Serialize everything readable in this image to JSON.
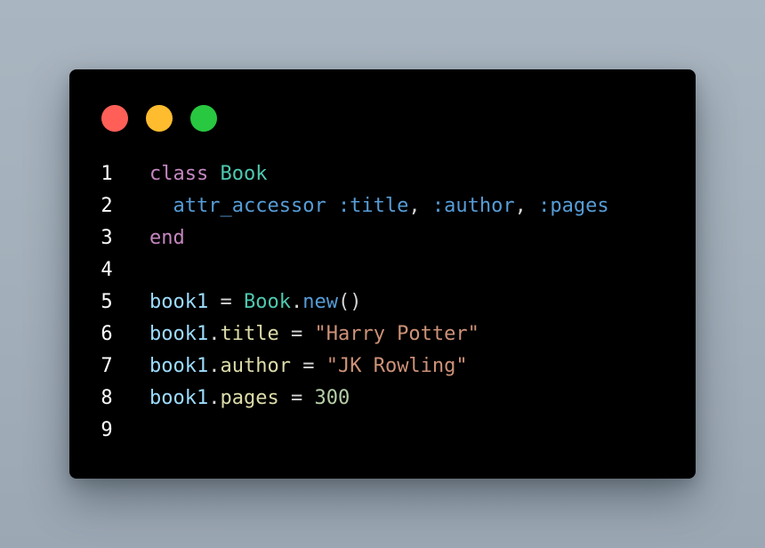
{
  "window_controls": [
    {
      "name": "close",
      "color": "#ff5f57"
    },
    {
      "name": "minimize",
      "color": "#febc2e"
    },
    {
      "name": "maximize",
      "color": "#28c840"
    }
  ],
  "colors": {
    "keyword": "#c586c0",
    "class": "#4ec9b0",
    "method": "#569cd6",
    "variable": "#9cdcfe",
    "property": "#dcdcaa",
    "string": "#ce9178",
    "number": "#b5cea8",
    "punctuation": "#d4d4d4",
    "line_number": "#ffffff",
    "background": "#000000"
  },
  "code": {
    "lines": [
      {
        "number": "1",
        "tokens": [
          {
            "t": "class",
            "k": "kw"
          },
          {
            "t": " ",
            "k": "punct"
          },
          {
            "t": "Book",
            "k": "class"
          }
        ]
      },
      {
        "number": "2",
        "tokens": [
          {
            "t": "  ",
            "k": "punct"
          },
          {
            "t": "attr_accessor",
            "k": "method"
          },
          {
            "t": " ",
            "k": "punct"
          },
          {
            "t": ":title",
            "k": "method"
          },
          {
            "t": ", ",
            "k": "punct"
          },
          {
            "t": ":author",
            "k": "method"
          },
          {
            "t": ", ",
            "k": "punct"
          },
          {
            "t": ":pages",
            "k": "method"
          }
        ]
      },
      {
        "number": "3",
        "tokens": [
          {
            "t": "end",
            "k": "kw"
          }
        ]
      },
      {
        "number": "4",
        "tokens": []
      },
      {
        "number": "5",
        "tokens": [
          {
            "t": "book1",
            "k": "var"
          },
          {
            "t": " = ",
            "k": "punct"
          },
          {
            "t": "Book",
            "k": "class"
          },
          {
            "t": ".",
            "k": "punct"
          },
          {
            "t": "new",
            "k": "method"
          },
          {
            "t": "()",
            "k": "punct"
          }
        ]
      },
      {
        "number": "6",
        "tokens": [
          {
            "t": "book1",
            "k": "var"
          },
          {
            "t": ".",
            "k": "punct"
          },
          {
            "t": "title",
            "k": "prop"
          },
          {
            "t": " = ",
            "k": "punct"
          },
          {
            "t": "\"Harry Potter\"",
            "k": "str"
          }
        ]
      },
      {
        "number": "7",
        "tokens": [
          {
            "t": "book1",
            "k": "var"
          },
          {
            "t": ".",
            "k": "punct"
          },
          {
            "t": "author",
            "k": "prop"
          },
          {
            "t": " = ",
            "k": "punct"
          },
          {
            "t": "\"JK Rowling\"",
            "k": "str"
          }
        ]
      },
      {
        "number": "8",
        "tokens": [
          {
            "t": "book1",
            "k": "var"
          },
          {
            "t": ".",
            "k": "punct"
          },
          {
            "t": "pages",
            "k": "prop"
          },
          {
            "t": " = ",
            "k": "punct"
          },
          {
            "t": "300",
            "k": "num"
          }
        ]
      },
      {
        "number": "9",
        "tokens": []
      }
    ]
  }
}
